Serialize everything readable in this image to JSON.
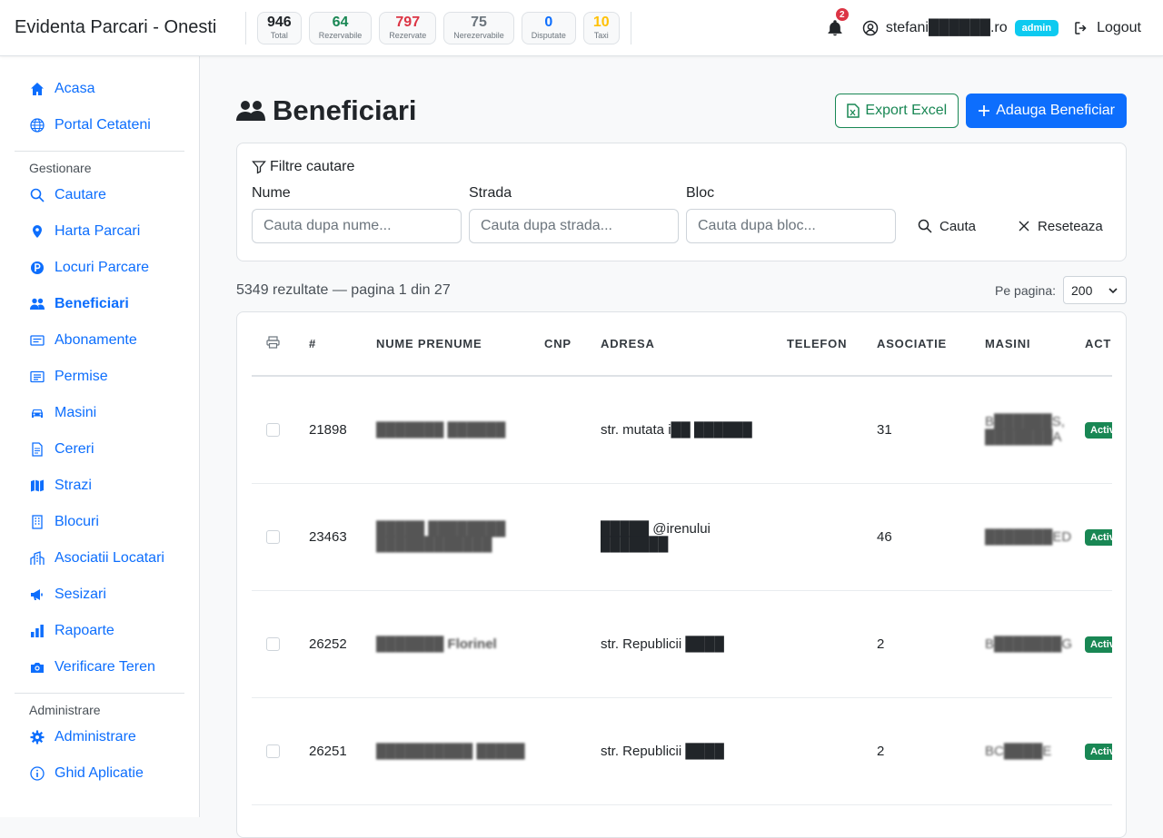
{
  "app": {
    "title": "Evidenta Parcari - Onesti"
  },
  "stats": [
    {
      "value": "946",
      "label": "Total",
      "color": "#212529"
    },
    {
      "value": "64",
      "label": "Rezervabile",
      "color": "#198754"
    },
    {
      "value": "797",
      "label": "Rezervate",
      "color": "#dc3545"
    },
    {
      "value": "75",
      "label": "Nerezervabile",
      "color": "#6c757d"
    },
    {
      "value": "0",
      "label": "Disputate",
      "color": "#0d6efd"
    },
    {
      "value": "10",
      "label": "Taxi",
      "color": "#ffc107"
    }
  ],
  "header": {
    "notifications": "2",
    "user": "stefani██████.ro",
    "role": "admin",
    "logout": "Logout"
  },
  "sidebar": {
    "items_top": [
      {
        "label": "Acasa",
        "icon": "home-icon"
      },
      {
        "label": "Portal Cetateni",
        "icon": "globe-icon"
      }
    ],
    "section_manage": "Gestionare",
    "items_manage": [
      {
        "label": "Cautare",
        "icon": "search-icon"
      },
      {
        "label": "Harta Parcari",
        "icon": "map-pin-icon"
      },
      {
        "label": "Locuri Parcare",
        "icon": "parking-icon"
      },
      {
        "label": "Beneficiari",
        "icon": "people-icon",
        "active": true
      },
      {
        "label": "Abonamente",
        "icon": "card-icon"
      },
      {
        "label": "Permise",
        "icon": "permit-icon"
      },
      {
        "label": "Masini",
        "icon": "car-icon"
      },
      {
        "label": "Cereri",
        "icon": "document-icon"
      },
      {
        "label": "Strazi",
        "icon": "map-icon"
      },
      {
        "label": "Blocuri",
        "icon": "building-icon"
      },
      {
        "label": "Asociatii Locatari",
        "icon": "buildings-icon"
      },
      {
        "label": "Sesizari",
        "icon": "megaphone-icon"
      },
      {
        "label": "Rapoarte",
        "icon": "bar-chart-icon"
      },
      {
        "label": "Verificare Teren",
        "icon": "camera-icon"
      }
    ],
    "section_admin": "Administrare",
    "items_admin": [
      {
        "label": "Administrare",
        "icon": "gear-icon"
      },
      {
        "label": "Ghid Aplicatie",
        "icon": "info-icon"
      }
    ]
  },
  "page": {
    "title": "Beneficiari",
    "export_label": "Export Excel",
    "add_label": "Adauga Beneficiar"
  },
  "filters": {
    "title": "Filtre cautare",
    "name_label": "Nume",
    "name_placeholder": "Cauta dupa nume...",
    "street_label": "Strada",
    "street_placeholder": "Cauta dupa strada...",
    "block_label": "Bloc",
    "block_placeholder": "Cauta dupa bloc...",
    "search_label": "Cauta",
    "reset_label": "Reseteaza"
  },
  "results": {
    "summary": "5349 rezultate — pagina 1 din 27",
    "per_page_label": "Pe pagina:",
    "per_page_value": "200"
  },
  "table": {
    "columns": [
      "#",
      "NUME PRENUME",
      "CNP",
      "ADRESA",
      "TELEFON",
      "ASOCIATIE",
      "MASINI",
      "ACTIV"
    ],
    "rows": [
      {
        "id": "21898",
        "name": "███████ ██████",
        "cnp": "",
        "address": "str. mutata i██ ██████",
        "phone": "",
        "assoc": "31",
        "cars": "B██████S, ███████A",
        "status": "Activ"
      },
      {
        "id": "23463",
        "name": "█████ ████████ ████████████",
        "cnp": "",
        "address": "█████ @irenului ███████",
        "phone": "",
        "assoc": "46",
        "cars": "███████ED",
        "status": "Activ"
      },
      {
        "id": "26252",
        "name": "███████ Florinel",
        "cnp": "",
        "address": "str. Republicii ████",
        "phone": "",
        "assoc": "2",
        "cars": "B███████G",
        "status": "Activ"
      },
      {
        "id": "26251",
        "name": "██████████ █████",
        "cnp": "",
        "address": "str. Republicii ████",
        "phone": "",
        "assoc": "2",
        "cars": "BC████E",
        "status": "Activ"
      }
    ]
  }
}
